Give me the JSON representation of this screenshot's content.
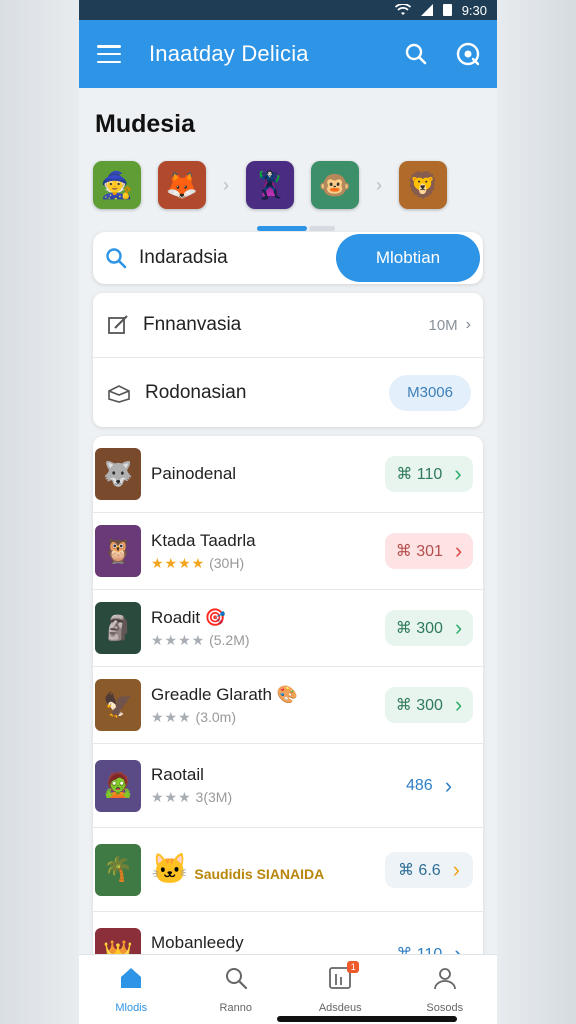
{
  "status_bar": {
    "time": "9:30"
  },
  "app_bar": {
    "title": "Inaatday Delicia",
    "icons": [
      "menu-icon",
      "search-icon",
      "help-icon"
    ]
  },
  "section": {
    "title": "Mudesia"
  },
  "carousel": {
    "thumbs": [
      {
        "emoji": "🧙",
        "color": "#5f9e35"
      },
      {
        "emoji": "🦊",
        "color": "#b14a2c"
      },
      {
        "emoji": "🦹",
        "color": "#4a2c82"
      },
      {
        "emoji": "🐵",
        "color": "#3d8f6a"
      },
      {
        "emoji": "🦁",
        "color": "#b06a2a"
      }
    ],
    "arrow": "›"
  },
  "search": {
    "text": "Indaradsia",
    "button_label": "Mlobtian"
  },
  "options": [
    {
      "label": "Fnnanvasia",
      "value": "10M",
      "chevron": "›"
    },
    {
      "label": "Rodonasian",
      "badge": "M3006"
    }
  ],
  "games": [
    {
      "name": "Painodenal",
      "stars": "",
      "meta": "",
      "price": "110",
      "pill": "green",
      "icon": "🐺",
      "icon_color": "#7a4a2d"
    },
    {
      "name": "Ktada Taadrla",
      "stars": "★★★★",
      "stars_style": "gold",
      "meta": "(30H)",
      "price": "301",
      "pill": "red",
      "icon": "🦉",
      "icon_color": "#6a3a78"
    },
    {
      "name": "Roadit 🎯",
      "stars": "★★★★",
      "stars_style": "gray",
      "meta": "(5.2M)",
      "price": "300",
      "pill": "green",
      "icon": "🗿",
      "icon_color": "#2b4a3e"
    },
    {
      "name": "Greadle Glarath 🎨",
      "stars": "★★★",
      "stars_style": "gray",
      "meta": "(3.0m)",
      "price": "300",
      "pill": "green",
      "icon": "🦅",
      "icon_color": "#8a5a2a"
    },
    {
      "name": "Raotail",
      "stars": "★★★",
      "stars_style": "gray",
      "meta": "3(3M)",
      "price": "486",
      "pill": "blue",
      "icon": "🧟",
      "icon_color": "#5a4b87"
    },
    {
      "name": "Saudidis SIANAIDA",
      "stars": "",
      "meta": "",
      "price": "6.6",
      "pill": "orange",
      "icon": "🌴",
      "icon_color": "#3f7a44",
      "mascot": "🐱"
    },
    {
      "name": "Mobanleedy",
      "stars": "★★★",
      "stars_style": "gold",
      "meta": "",
      "price": "110",
      "pill": "blue",
      "icon": "👑",
      "icon_color": "#8b2f3a"
    }
  ],
  "currency_symbol": "⌘",
  "bottom_nav": [
    {
      "label": "Mlodis",
      "icon": "home-icon",
      "active": true
    },
    {
      "label": "Ranno",
      "icon": "search-icon",
      "active": false
    },
    {
      "label": "Adsdeus",
      "icon": "library-icon",
      "active": false,
      "badge": "1"
    },
    {
      "label": "Sosods",
      "icon": "profile-icon",
      "active": false
    }
  ],
  "colors": {
    "primary": "#2e94e6",
    "background": "#eef1f4"
  }
}
